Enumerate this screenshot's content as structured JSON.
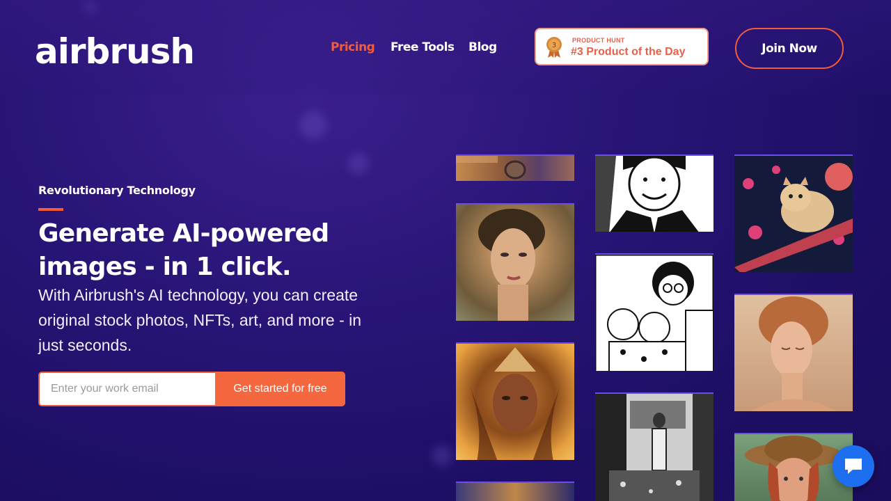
{
  "header": {
    "logo": "airbrush",
    "nav": {
      "pricing": "Pricing",
      "free_tools": "Free Tools",
      "blog": "Blog"
    },
    "product_hunt": {
      "rank": "3",
      "label": "PRODUCT HUNT",
      "title": "#3 Product of the Day"
    },
    "join_label": "Join Now"
  },
  "hero": {
    "eyebrow": "Revolutionary Technology",
    "headline": "Generate AI-powered images - in 1 click.",
    "subtext": "With Airbrush's AI technology, you can create original stock photos, NFTs, art, and more - in just seconds.",
    "email_placeholder": "Enter your work email",
    "cta_label": "Get started for free"
  },
  "colors": {
    "accent": "#f25c3b",
    "background": "#1e0f66",
    "chat": "#1e6ff0"
  },
  "icons": {
    "medal": "medal-icon",
    "chat": "chat-bubble-icon"
  }
}
